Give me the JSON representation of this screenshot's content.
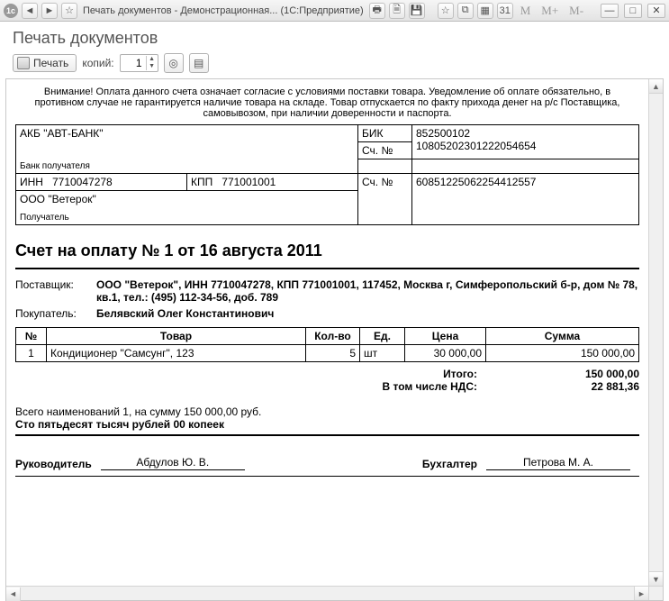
{
  "window": {
    "title": "Печать документов - Демонстрационная... (1С:Предприятие)",
    "app_icon_label": "1c",
    "mem_buttons": [
      "M",
      "M+",
      "M-"
    ]
  },
  "heading": "Печать документов",
  "toolbar": {
    "print_label": "Печать",
    "copies_label": "копий:",
    "copies_value": "1"
  },
  "notice": "Внимание! Оплата данного счета означает согласие с условиями поставки товара. Уведомление об оплате обязательно, в противном случае не гарантируется наличие товара на складе. Товар отпускается по факту прихода денег на р/с Поставщика, самовывозом, при наличии доверенности и паспорта.",
  "bank": {
    "bank_name": "АКБ \"АВТ-БАНК\"",
    "bank_sub": "Банк получателя",
    "bik_label": "БИК",
    "bik_value": "852500102",
    "acct1_label": "Сч. №",
    "acct1_value": "10805202301222054654",
    "inn_label": "ИНН",
    "inn_value": "7710047278",
    "kpp_label": "КПП",
    "kpp_value": "771001001",
    "acct2_label": "Сч. №",
    "acct2_value": "60851225062254412557",
    "payee_name": "ООО \"Ветерок\"",
    "payee_sub": "Получатель"
  },
  "doc_title": "Счет на оплату № 1 от 16 августа 2011",
  "supplier": {
    "label": "Поставщик:",
    "value": "ООО \"Ветерок\", ИНН 7710047278, КПП 771001001, 117452, Москва г, Симферопольский б-р, дом № 78, кв.1, тел.: (495) 112-34-56, доб. 789"
  },
  "buyer": {
    "label": "Покупатель:",
    "value": "Белявский Олег Константинович"
  },
  "items": {
    "headers": {
      "n": "№",
      "name": "Товар",
      "qty": "Кол-во",
      "unit": "Ед.",
      "price": "Цена",
      "sum": "Сумма"
    },
    "rows": [
      {
        "n": "1",
        "name": "Кондиционер \"Самсунг\", 123",
        "qty": "5",
        "unit": "шт",
        "price": "30 000,00",
        "sum": "150 000,00"
      }
    ]
  },
  "totals": {
    "total_label": "Итого:",
    "total_value": "150 000,00",
    "vat_label": "В том числе НДС:",
    "vat_value": "22 881,36"
  },
  "summary": {
    "line1": "Всего наименований 1, на сумму 150 000,00 руб.",
    "line2": "Сто пятьдесят тысяч рублей 00 копеек"
  },
  "signatures": {
    "head_label": "Руководитель",
    "head_name": "Абдулов Ю. В.",
    "acc_label": "Бухгалтер",
    "acc_name": "Петрова М. А."
  }
}
